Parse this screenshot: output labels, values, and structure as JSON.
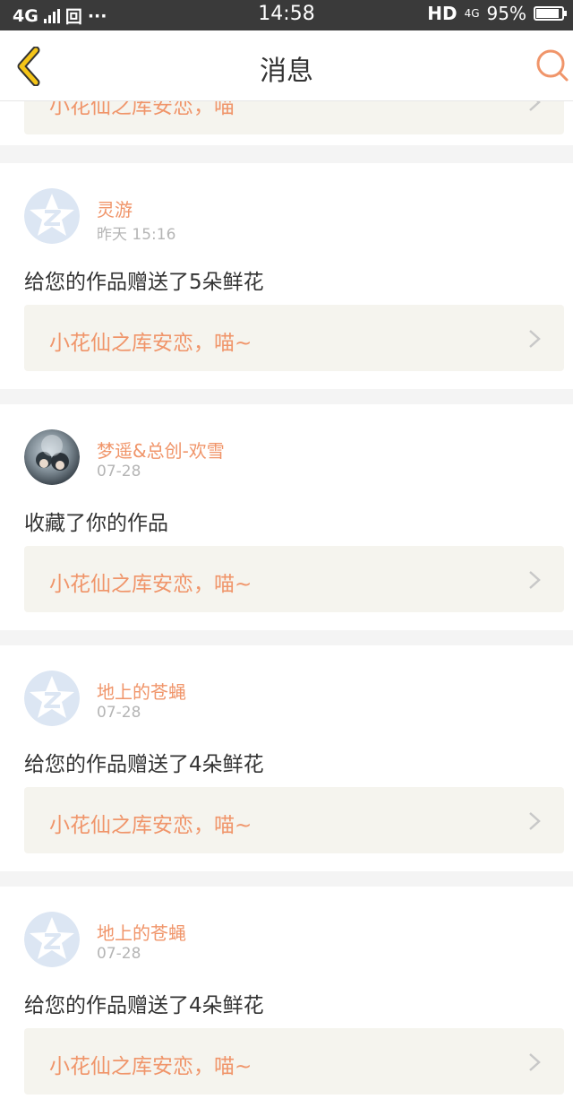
{
  "status_bar": {
    "network": "4G",
    "extra_icon": "回",
    "dots": "···",
    "time": "14:58",
    "hd": "HD",
    "net2": "4G",
    "battery": "95%",
    "battery_level": 0.95
  },
  "navbar": {
    "title": "消息",
    "back_icon": "chevron-left-icon",
    "search_icon": "search-icon"
  },
  "colors": {
    "accent": "#f0956a",
    "back_arrow": "#f5c518",
    "work_bg": "#f5f4ee"
  },
  "partial_item": {
    "work_title": "小花仙之库安恋，喵"
  },
  "messages": [
    {
      "user": "灵游",
      "time": "昨天 15:16",
      "action": "给您的作品赠送了5朵鲜花",
      "work_title": "小花仙之库安恋，喵~",
      "avatar": "default-avatar-icon"
    },
    {
      "user": "梦遥&总创-欢雪",
      "time": "07-28",
      "action": "收藏了你的作品",
      "work_title": "小花仙之库安恋，喵~",
      "avatar": "photo-avatar"
    },
    {
      "user": "地上的苍蝇",
      "time": "07-28",
      "action": "给您的作品赠送了4朵鲜花",
      "work_title": "小花仙之库安恋，喵~",
      "avatar": "default-avatar-icon"
    },
    {
      "user": "地上的苍蝇",
      "time": "07-28",
      "action": "给您的作品赠送了4朵鲜花",
      "work_title": "小花仙之库安恋，喵~",
      "avatar": "default-avatar-icon"
    }
  ]
}
